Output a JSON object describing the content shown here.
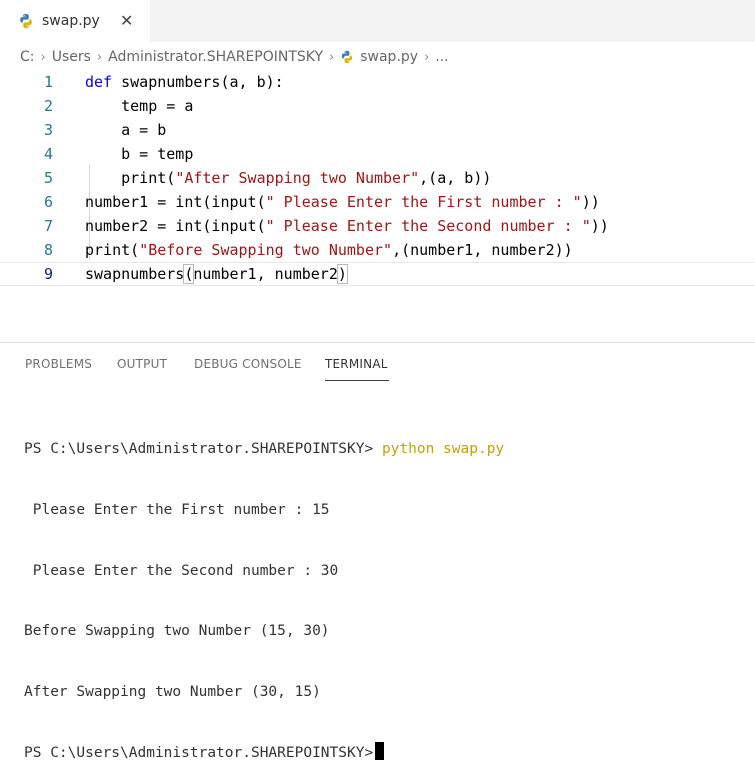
{
  "tab": {
    "label": "swap.py",
    "close_glyph": "✕"
  },
  "breadcrumb": {
    "items": [
      "C:",
      "Users",
      "Administrator.SHAREPOINTSKY",
      "swap.py",
      "..."
    ],
    "separator": "›"
  },
  "editor": {
    "lines": [
      {
        "num": "1",
        "tokens": [
          {
            "t": "def",
            "k": "kw"
          },
          {
            "t": " swapnumbers(a, b):",
            "k": "plain"
          }
        ]
      },
      {
        "num": "2",
        "tokens": [
          {
            "t": "    temp = a",
            "k": "plain"
          }
        ]
      },
      {
        "num": "3",
        "tokens": [
          {
            "t": "    a = b",
            "k": "plain"
          }
        ]
      },
      {
        "num": "4",
        "tokens": [
          {
            "t": "    b = temp",
            "k": "plain"
          }
        ]
      },
      {
        "num": "5",
        "tokens": [
          {
            "t": "    print(",
            "k": "plain"
          },
          {
            "t": "\"After Swapping two Number\"",
            "k": "str"
          },
          {
            "t": ",(a, b))",
            "k": "plain"
          }
        ]
      },
      {
        "num": "6",
        "tokens": [
          {
            "t": "number1 = int(input(",
            "k": "plain"
          },
          {
            "t": "\" Please Enter the First number : \"",
            "k": "str"
          },
          {
            "t": "))",
            "k": "plain"
          }
        ]
      },
      {
        "num": "7",
        "tokens": [
          {
            "t": "number2 = int(input(",
            "k": "plain"
          },
          {
            "t": "\" Please Enter the Second number : \"",
            "k": "str"
          },
          {
            "t": "))",
            "k": "plain"
          }
        ]
      },
      {
        "num": "8",
        "tokens": [
          {
            "t": "print(",
            "k": "plain"
          },
          {
            "t": "\"Before Swapping two Number\"",
            "k": "str"
          },
          {
            "t": ",(number1, number2))",
            "k": "plain"
          }
        ]
      },
      {
        "num": "9",
        "tokens": [
          {
            "t": "swapnumbers",
            "k": "plain"
          },
          {
            "t": "(",
            "k": "plain",
            "box": true
          },
          {
            "t": "number1, number2",
            "k": "plain"
          },
          {
            "t": ")",
            "k": "plain",
            "box": true
          }
        ]
      }
    ],
    "active_line": 9
  },
  "panel": {
    "tabs": [
      "PROBLEMS",
      "OUTPUT",
      "DEBUG CONSOLE",
      "TERMINAL"
    ],
    "active": "TERMINAL"
  },
  "terminal": {
    "prompt": "PS C:\\Users\\Administrator.SHAREPOINTSKY>",
    "command": "python swap.py",
    "output": [
      " Please Enter the First number : 15",
      " Please Enter the Second number : 30",
      "Before Swapping two Number (15, 30)",
      "After Swapping two Number (30, 15)"
    ],
    "final_prompt": "PS C:\\Users\\Administrator.SHAREPOINTSKY>"
  },
  "colors": {
    "keyword": "#0000ff",
    "string": "#a31515",
    "line_number": "#237893",
    "terminal_command": "#c8a100"
  }
}
